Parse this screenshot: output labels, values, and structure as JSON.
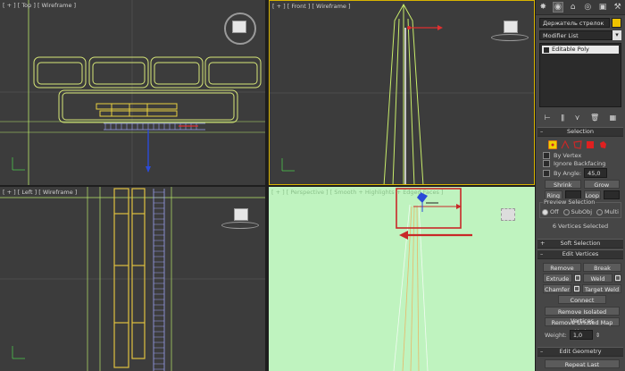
{
  "viewports": {
    "top": {
      "label": "[ + ] [ Top ] [ Wireframe ]"
    },
    "front": {
      "label": "[ + ] [ Front ] [ Wireframe ]"
    },
    "left": {
      "label": "[ + ] [ Left ] [ Wireframe ]"
    },
    "perspective": {
      "label": "[ + ] [ Perspective ] [ Smooth + Highlights + Edged Faces ]"
    }
  },
  "panel": {
    "tabs": [
      "create-icon",
      "modify-icon",
      "hierarchy-icon",
      "motion-icon",
      "display-icon",
      "utilities-icon"
    ],
    "object_name": "Держатель стрелок",
    "object_color": "#f0c400",
    "modifier_list": "Modifier List",
    "stack": {
      "item": "Editable Poly"
    },
    "selection": {
      "title": "Selection",
      "by_vertex": "By Vertex",
      "ignore_backfacing": "Ignore Backfacing",
      "by_angle": "By Angle:",
      "by_angle_value": "45,0",
      "shrink": "Shrink",
      "grow": "Grow",
      "ring": "Ring",
      "loop": "Loop",
      "preview_title": "Preview Selection",
      "off": "Off",
      "subobj": "SubObj",
      "multi": "Multi",
      "status": "6 Vertices Selected"
    },
    "soft_selection": {
      "title": "Soft Selection"
    },
    "edit_vertices": {
      "title": "Edit Vertices",
      "remove": "Remove",
      "break": "Break",
      "extrude": "Extrude",
      "weld": "Weld",
      "chamfer": "Chamfer",
      "target_weld": "Target Weld",
      "connect": "Connect",
      "remove_isolated": "Remove Isolated Vertices",
      "remove_unused": "Remove Unused Map Verts",
      "weight_label": "Weight:",
      "weight_value": "1,0"
    },
    "edit_geometry": {
      "title": "Edit Geometry",
      "repeat_last": "Repeat Last"
    }
  }
}
